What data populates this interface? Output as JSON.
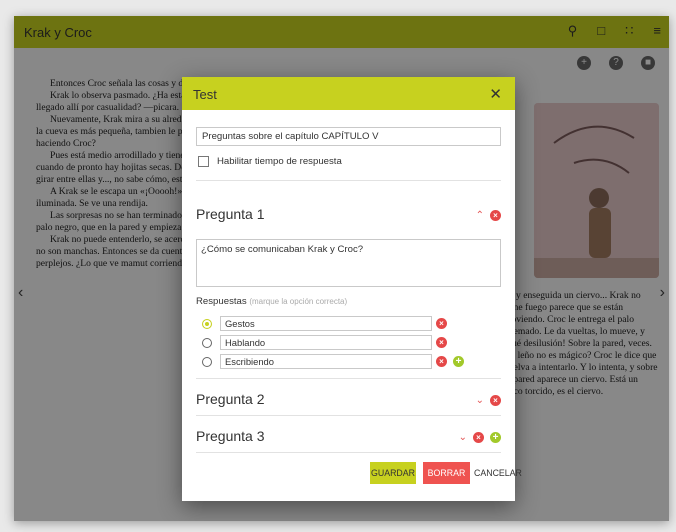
{
  "app": {
    "title": "Krak y Croc"
  },
  "reader": {
    "left_paragraphs": [
      "Entonces Croc señala las cosas y dice: \"¿Qué es eso?\"",
      "Krak lo observa pasmado. ¿Ha estado ahí siempre? ¿Entonces no han llegado allí por casualidad? —picara.",
      "Nuevamente, Krak mira a su alrededor, acostumbrándose a la oscuridad: la cueva es más pequeña, tambien le parece mucho más... ¿Qué estará haciendo Croc?",
      "Pues está medio arrodillado y tiene un palo se apoya sobre una madera, cuando de pronto hay hojitas secas. De pronto mueve las manos y se pone a girar entre ellas y..., no sabe cómo, estupendo que crece muy rápido.",
      "A Krak se le escapa un «¡Ooooh!» y todos bailan. Ahora la cueva está iluminada. Se ve una rendija.",
      "Las sorpresas no se han terminado: Croc agarra la piel y vuelve con un palo negro, que en la pared y empieza a mancharla con él.",
      "Krak no puede entenderlo, se acerca y pregunta para qué hace eso. Pero no son manchas. Entonces se da cuenta. Los ojos de Krak brillantes y además perplejos. ¿Lo que ve mamut corriendo. Krak jamás había visto."
    ],
    "right_paragraphs": [
      "..., y enseguida un ciervo... Krak no tiene fuego parece que se están moviendo. Croc le entrega el palo quemado. Le da vueltas, lo mueve, y ¡qué desilusión! Sobre la pared, veces. ¿el leño no es mágico? Croc le dice que vuelva a intentarlo. Y lo intenta, y sobre la pared aparece un ciervo. Está un poco torcido, es el ciervo."
    ]
  },
  "modal": {
    "title": "Test",
    "chapter_title_value": "Preguntas sobre el capítulo CAPÍTULO V",
    "enable_time_label": "Habilitar tiempo de respuesta",
    "questions": [
      {
        "label": "Pregunta 1",
        "text": "¿Cómo se comunicaban Krak y Croc?"
      },
      {
        "label": "Pregunta 2"
      },
      {
        "label": "Pregunta 3"
      }
    ],
    "answers_label": "Respuestas",
    "answers_hint": "(marque la opción correcta)",
    "answers": [
      {
        "text": "Gestos",
        "selected": true
      },
      {
        "text": "Hablando",
        "selected": false
      },
      {
        "text": "Escribiendo",
        "selected": false
      }
    ],
    "buttons": {
      "save": "GUARDAR",
      "delete": "BORRAR",
      "cancel": "CANCELAR"
    }
  },
  "colors": {
    "accent": "#c7d11f",
    "danger": "#e54848",
    "add": "#a2c92a"
  },
  "icons": [
    "search-icon",
    "bookmark-icon",
    "fullscreen-icon",
    "menu-icon",
    "close-icon",
    "chevron-up-icon",
    "chevron-down-icon",
    "remove-icon",
    "add-icon"
  ]
}
